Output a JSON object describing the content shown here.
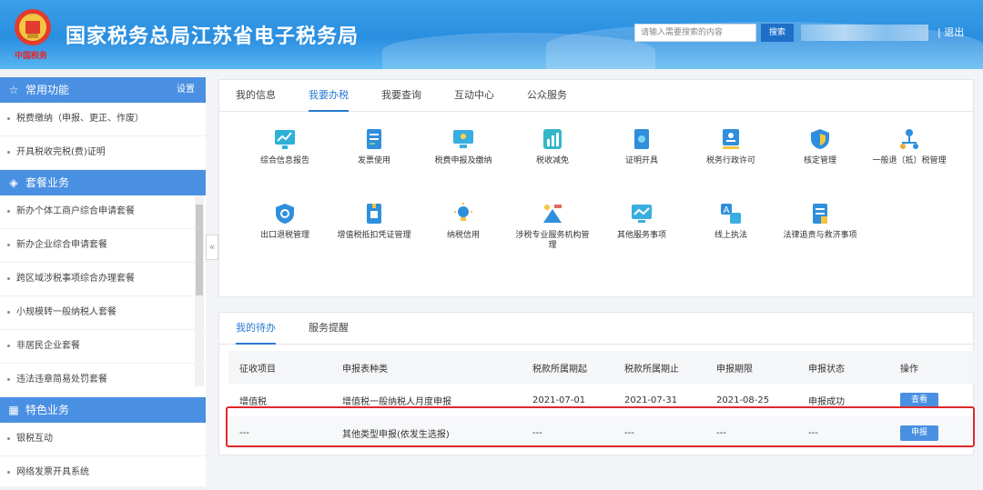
{
  "header": {
    "emblem_caption": "中国税务",
    "title": "国家税务总局江苏省电子税务局",
    "search_placeholder": "请输入需要搜索的内容",
    "search_button": "搜索",
    "logout": "| 退出"
  },
  "sidebar": {
    "common": {
      "title": "常用功能",
      "icon": "star-icon",
      "settings": "设置",
      "items": [
        "税费缴纳（申报、更正、作废）",
        "开具税收完税(费)证明"
      ]
    },
    "package": {
      "title": "套餐业务",
      "icon": "layers-icon",
      "items": [
        "新办个体工商户综合申请套餐",
        "新办企业综合申请套餐",
        "跨区域涉税事项综合办理套餐",
        "小规模转一般纳税人套餐",
        "非居民企业套餐",
        "违法违章简易处罚套餐"
      ]
    },
    "special": {
      "title": "特色业务",
      "icon": "grid-icon",
      "items": [
        "银税互动",
        "网络发票开具系统"
      ]
    }
  },
  "top_tabs": [
    "我的信息",
    "我要办税",
    "我要查询",
    "互动中心",
    "公众服务"
  ],
  "tiles": [
    {
      "label": "综合信息报告",
      "icon": "report-chart-icon"
    },
    {
      "label": "发票使用",
      "icon": "invoice-icon"
    },
    {
      "label": "税费申报及缴纳",
      "icon": "monitor-icon"
    },
    {
      "label": "税收减免",
      "icon": "bar-chart-icon"
    },
    {
      "label": "证明开具",
      "icon": "certificate-icon"
    },
    {
      "label": "税务行政许可",
      "icon": "license-icon"
    },
    {
      "label": "核定管理",
      "icon": "shield-icon"
    },
    {
      "label": "一般退（抵）税管理",
      "icon": "network-icon"
    },
    {
      "label": "出口退税管理",
      "icon": "shield-check-icon"
    },
    {
      "label": "增值税抵扣凭证管理",
      "icon": "document-icon"
    },
    {
      "label": "纳税信用",
      "icon": "bulb-icon"
    },
    {
      "label": "涉税专业服务机构管理",
      "icon": "tools-icon"
    },
    {
      "label": "其他服务事项",
      "icon": "trend-monitor-icon"
    },
    {
      "label": "线上执法",
      "icon": "translate-icon"
    },
    {
      "label": "法律追责与救济事项",
      "icon": "file-list-icon"
    }
  ],
  "bottom_tabs": [
    "我的待办",
    "服务提醒"
  ],
  "table": {
    "headers": [
      "征收项目",
      "申报表种类",
      "税款所属期起",
      "税款所属期止",
      "申报期限",
      "申报状态",
      "操作"
    ],
    "rows": [
      [
        "增值税",
        "增值税一般纳税人月度申报",
        "2021-07-01",
        "2021-07-31",
        "2021-08-25",
        "申报成功",
        "查看"
      ],
      [
        "---",
        "其他类型申报(依发生选报)",
        "---",
        "---",
        "---",
        "---",
        "申报"
      ]
    ]
  },
  "colors": {
    "accent": "#4a90e2",
    "header": "#2a8ee0",
    "highlight_box": "#e0282a"
  }
}
